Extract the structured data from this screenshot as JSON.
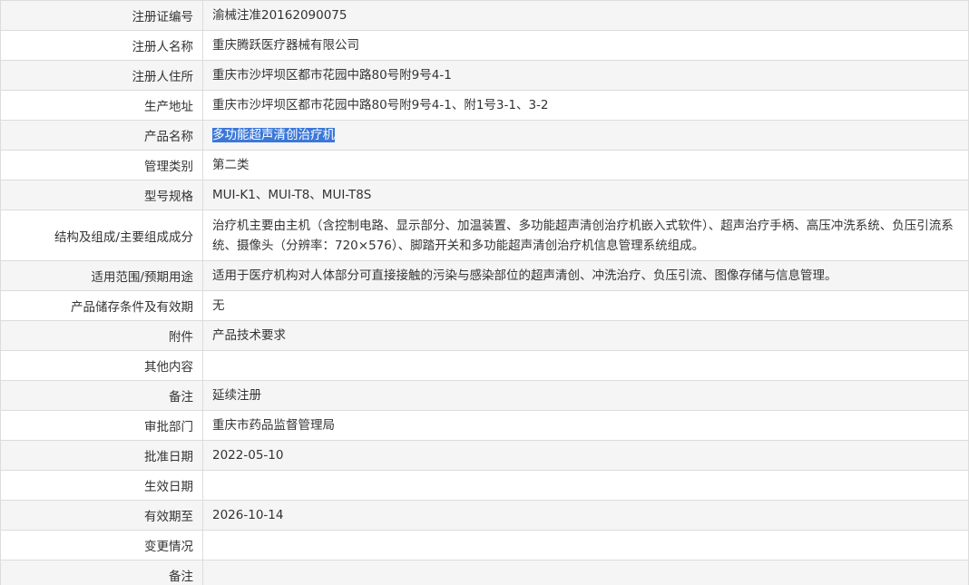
{
  "rows": [
    {
      "label": "注册证编号",
      "value": "渝械注准20162090075"
    },
    {
      "label": "注册人名称",
      "value": "重庆腾跃医疗器械有限公司"
    },
    {
      "label": "注册人住所",
      "value": "重庆市沙坪坝区都市花园中路80号附9号4-1"
    },
    {
      "label": "生产地址",
      "value": "重庆市沙坪坝区都市花园中路80号附9号4-1、附1号3-1、3-2"
    },
    {
      "label": "产品名称",
      "value": "多功能超声清创治疗机"
    },
    {
      "label": "管理类别",
      "value": "第二类"
    },
    {
      "label": "型号规格",
      "value": "MUI-K1、MUI-T8、MUI-T8S"
    },
    {
      "label": "结构及组成/主要组成成分",
      "value": "治疗机主要由主机（含控制电路、显示部分、加温装置、多功能超声清创治疗机嵌入式软件）、超声治疗手柄、高压冲洗系统、负压引流系统、摄像头（分辨率：720×576）、脚踏开关和多功能超声清创治疗机信息管理系统组成。"
    },
    {
      "label": "适用范围/预期用途",
      "value": "适用于医疗机构对人体部分可直接接触的污染与感染部位的超声清创、冲洗治疗、负压引流、图像存储与信息管理。"
    },
    {
      "label": "产品储存条件及有效期",
      "value": "无"
    },
    {
      "label": "附件",
      "value": "产品技术要求"
    },
    {
      "label": "其他内容",
      "value": ""
    },
    {
      "label": "备注",
      "value": "延续注册"
    },
    {
      "label": "审批部门",
      "value": "重庆市药品监督管理局"
    },
    {
      "label": "批准日期",
      "value": "2022-05-10"
    },
    {
      "label": "生效日期",
      "value": ""
    },
    {
      "label": "有效期至",
      "value": "2026-10-14"
    },
    {
      "label": "变更情况",
      "value": ""
    },
    {
      "label": "备注",
      "value": ""
    }
  ],
  "colors": {
    "border": "#dcdcdc",
    "odd_row_bg": "#f5f5f5",
    "even_row_bg": "#ffffff",
    "selection_bg": "#3b78d8"
  }
}
